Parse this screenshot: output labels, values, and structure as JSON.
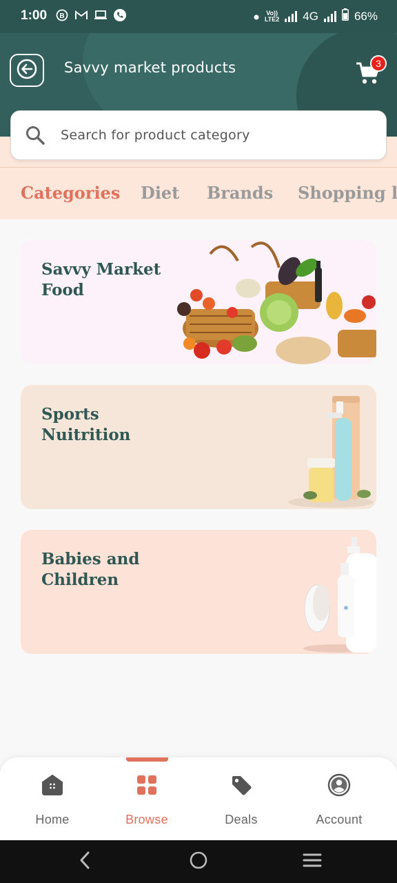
{
  "status_bar": {
    "time": "1:00",
    "left_icons": [
      "b-badge-icon",
      "gmail-icon",
      "laptop-icon",
      "phone-icon"
    ],
    "network_label_top": "Vo))",
    "network_label_bottom": "LTE2",
    "network_type": "4G",
    "battery": "66%"
  },
  "header": {
    "title": "Savvy market products",
    "cart_count": "3"
  },
  "search": {
    "placeholder": "Search for product category"
  },
  "tabs": [
    {
      "label": "Categories",
      "active": true
    },
    {
      "label": "Diet",
      "active": false
    },
    {
      "label": "Brands",
      "active": false
    },
    {
      "label": "Shopping l",
      "active": false
    }
  ],
  "categories": [
    {
      "title": "Savvy Market\nFood",
      "bg": "#fdf1fa"
    },
    {
      "title": "Sports\nNuitrition",
      "bg": "#f6e6d9"
    },
    {
      "title": "Babies and\nChildren",
      "bg": "#fde2d8"
    }
  ],
  "bottom_nav": [
    {
      "label": "Home",
      "icon": "home-icon",
      "active": false
    },
    {
      "label": "Browse",
      "icon": "grid-icon",
      "active": true
    },
    {
      "label": "Deals",
      "icon": "tag-icon",
      "active": false
    },
    {
      "label": "Account",
      "icon": "account-icon",
      "active": false
    }
  ],
  "colors": {
    "header_bg": "#33605c",
    "accent": "#e0715c",
    "tabs_bg": "#fde6da",
    "badge": "#e8211b"
  }
}
